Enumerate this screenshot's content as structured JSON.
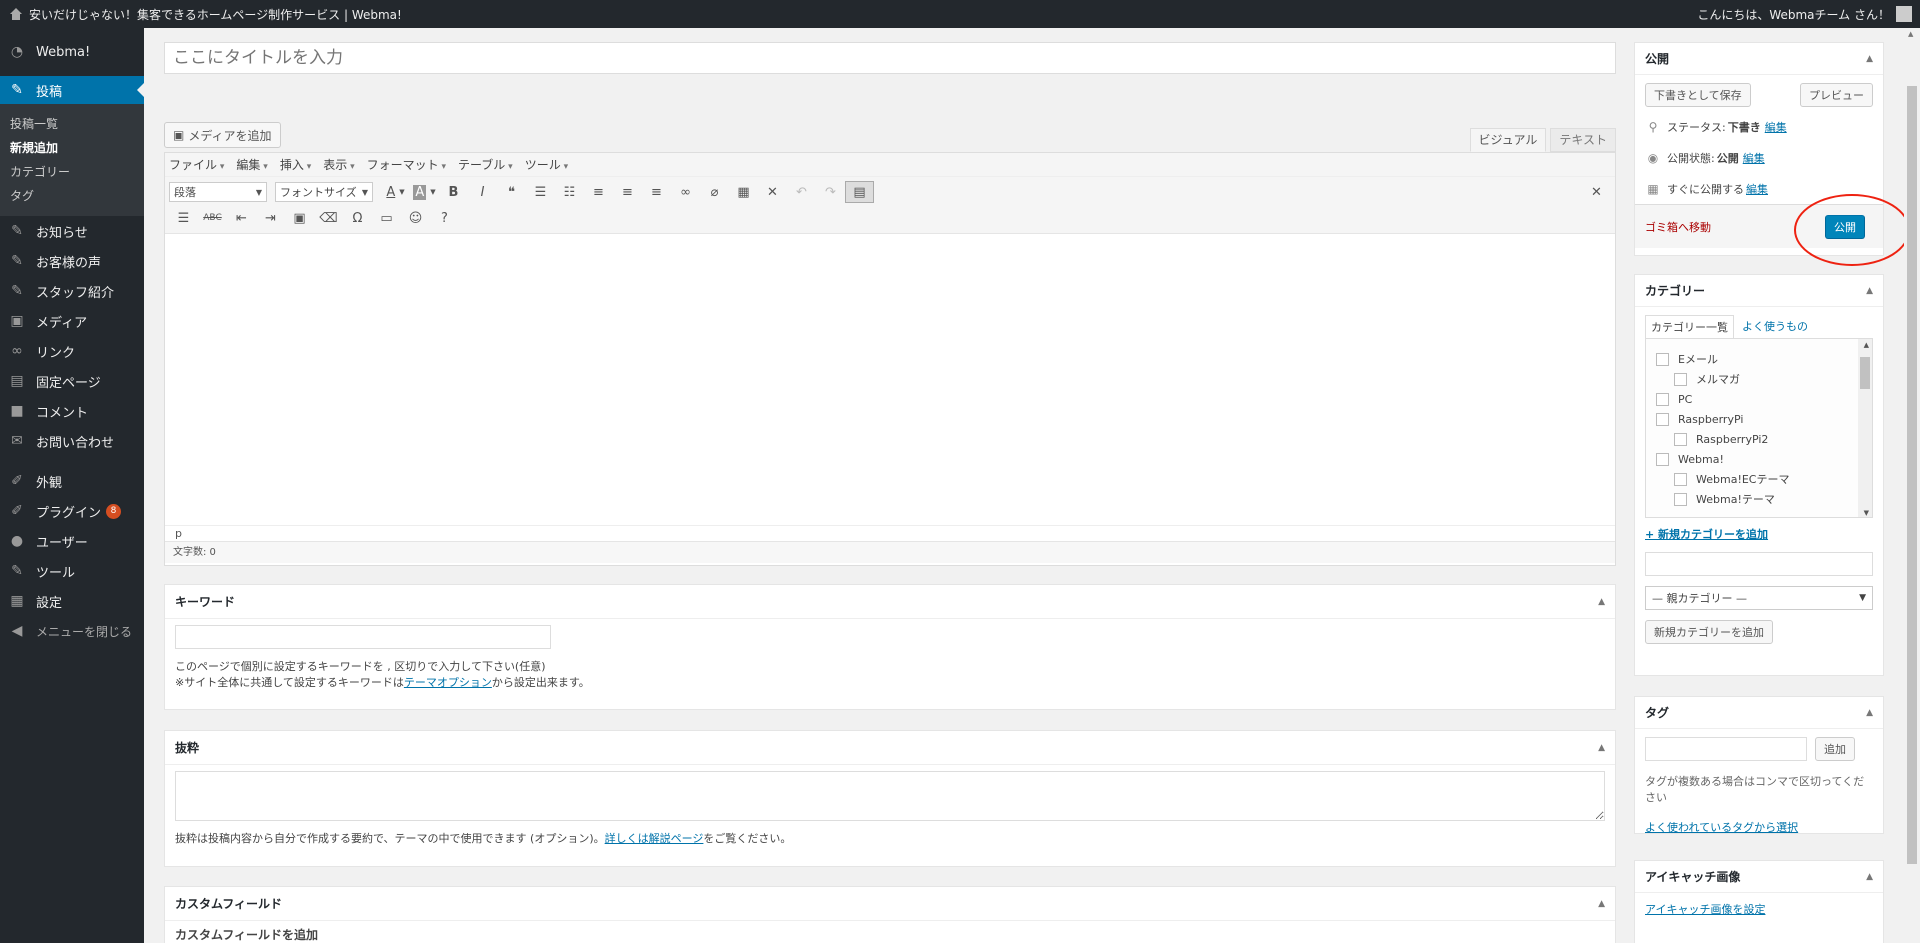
{
  "adminbar": {
    "site_title": "安いだけじゃない！集客できるホームページ制作サービス | Webma!",
    "howdy": "こんにちは、Webmaチーム さん！"
  },
  "sidebar": {
    "brand": "Webma!",
    "current": "投稿",
    "submenu": [
      "投稿一覧",
      "新規追加",
      "カテゴリー",
      "タグ"
    ],
    "items": [
      "お知らせ",
      "お客様の声",
      "スタッフ紹介",
      "メディア",
      "リンク",
      "固定ページ",
      "コメント",
      "お問い合わせ",
      "外観",
      "プラグイン",
      "ユーザー",
      "ツール",
      "設定"
    ],
    "plugin_badge": "8",
    "collapse": "メニューを閉じる"
  },
  "editor": {
    "title_placeholder": "ここにタイトルを入力",
    "add_media": "メディアを追加",
    "tab_visual": "ビジュアル",
    "tab_text": "テキスト",
    "menus": [
      "ファイル",
      "編集",
      "挿入",
      "表示",
      "フォーマット",
      "テーブル",
      "ツール"
    ],
    "format_select": "段落",
    "fontsize_select": "フォントサイズ",
    "path": "p",
    "wordcount": "文字数: 0"
  },
  "keyword_box": {
    "title": "キーワード",
    "help1": "このページで個別に設定するキーワードを , 区切りで入力して下さい(任意)",
    "help2_pre": "※サイト全体に共通して設定するキーワードは",
    "help2_link": "テーマオプション",
    "help2_post": "から設定出来ます。"
  },
  "excerpt_box": {
    "title": "抜粋",
    "help_pre": "抜粋は投稿内容から自分で作成する要約で、テーマの中で使用できます (オプション)。",
    "help_link": "詳しくは解説ページ",
    "help_post": "をご覧ください。"
  },
  "custom_box": {
    "title": "カスタムフィールド",
    "sub": "カスタムフィールドを追加"
  },
  "publish": {
    "title": "公開",
    "save_draft": "下書きとして保存",
    "preview": "プレビュー",
    "status_label": "ステータス:",
    "status_value": "下書き",
    "visibility_label": "公開状態:",
    "visibility_value": "公開",
    "schedule_label": "すぐに公開する",
    "edit": "編集",
    "trash": "ゴミ箱へ移動",
    "publish_btn": "公開"
  },
  "categories": {
    "title": "カテゴリー",
    "tab_all": "カテゴリー一覧",
    "tab_popular": "よく使うもの",
    "list": [
      {
        "name": "Eメール",
        "indent": 0
      },
      {
        "name": "メルマガ",
        "indent": 1
      },
      {
        "name": "PC",
        "indent": 0
      },
      {
        "name": "RaspberryPi",
        "indent": 0
      },
      {
        "name": "RaspberryPi2",
        "indent": 1
      },
      {
        "name": "Webma!",
        "indent": 0
      },
      {
        "name": "Webma!ECテーマ",
        "indent": 1
      },
      {
        "name": "Webma!テーマ",
        "indent": 1
      }
    ],
    "add_new_link": "+ 新規カテゴリーを追加",
    "parent_select": "— 親カテゴリー —",
    "add_button": "新規カテゴリーを追加"
  },
  "tags": {
    "title": "タグ",
    "add": "追加",
    "help": "タグが複数ある場合はコンマで区切ってください",
    "popular_link": "よく使われているタグから選択"
  },
  "featured": {
    "title": "アイキャッチ画像",
    "set_link": "アイキャッチ画像を設定"
  },
  "colors": {
    "accent": "#0073aa",
    "publish": "#0085ba",
    "highlight_circle": "#e21111"
  }
}
